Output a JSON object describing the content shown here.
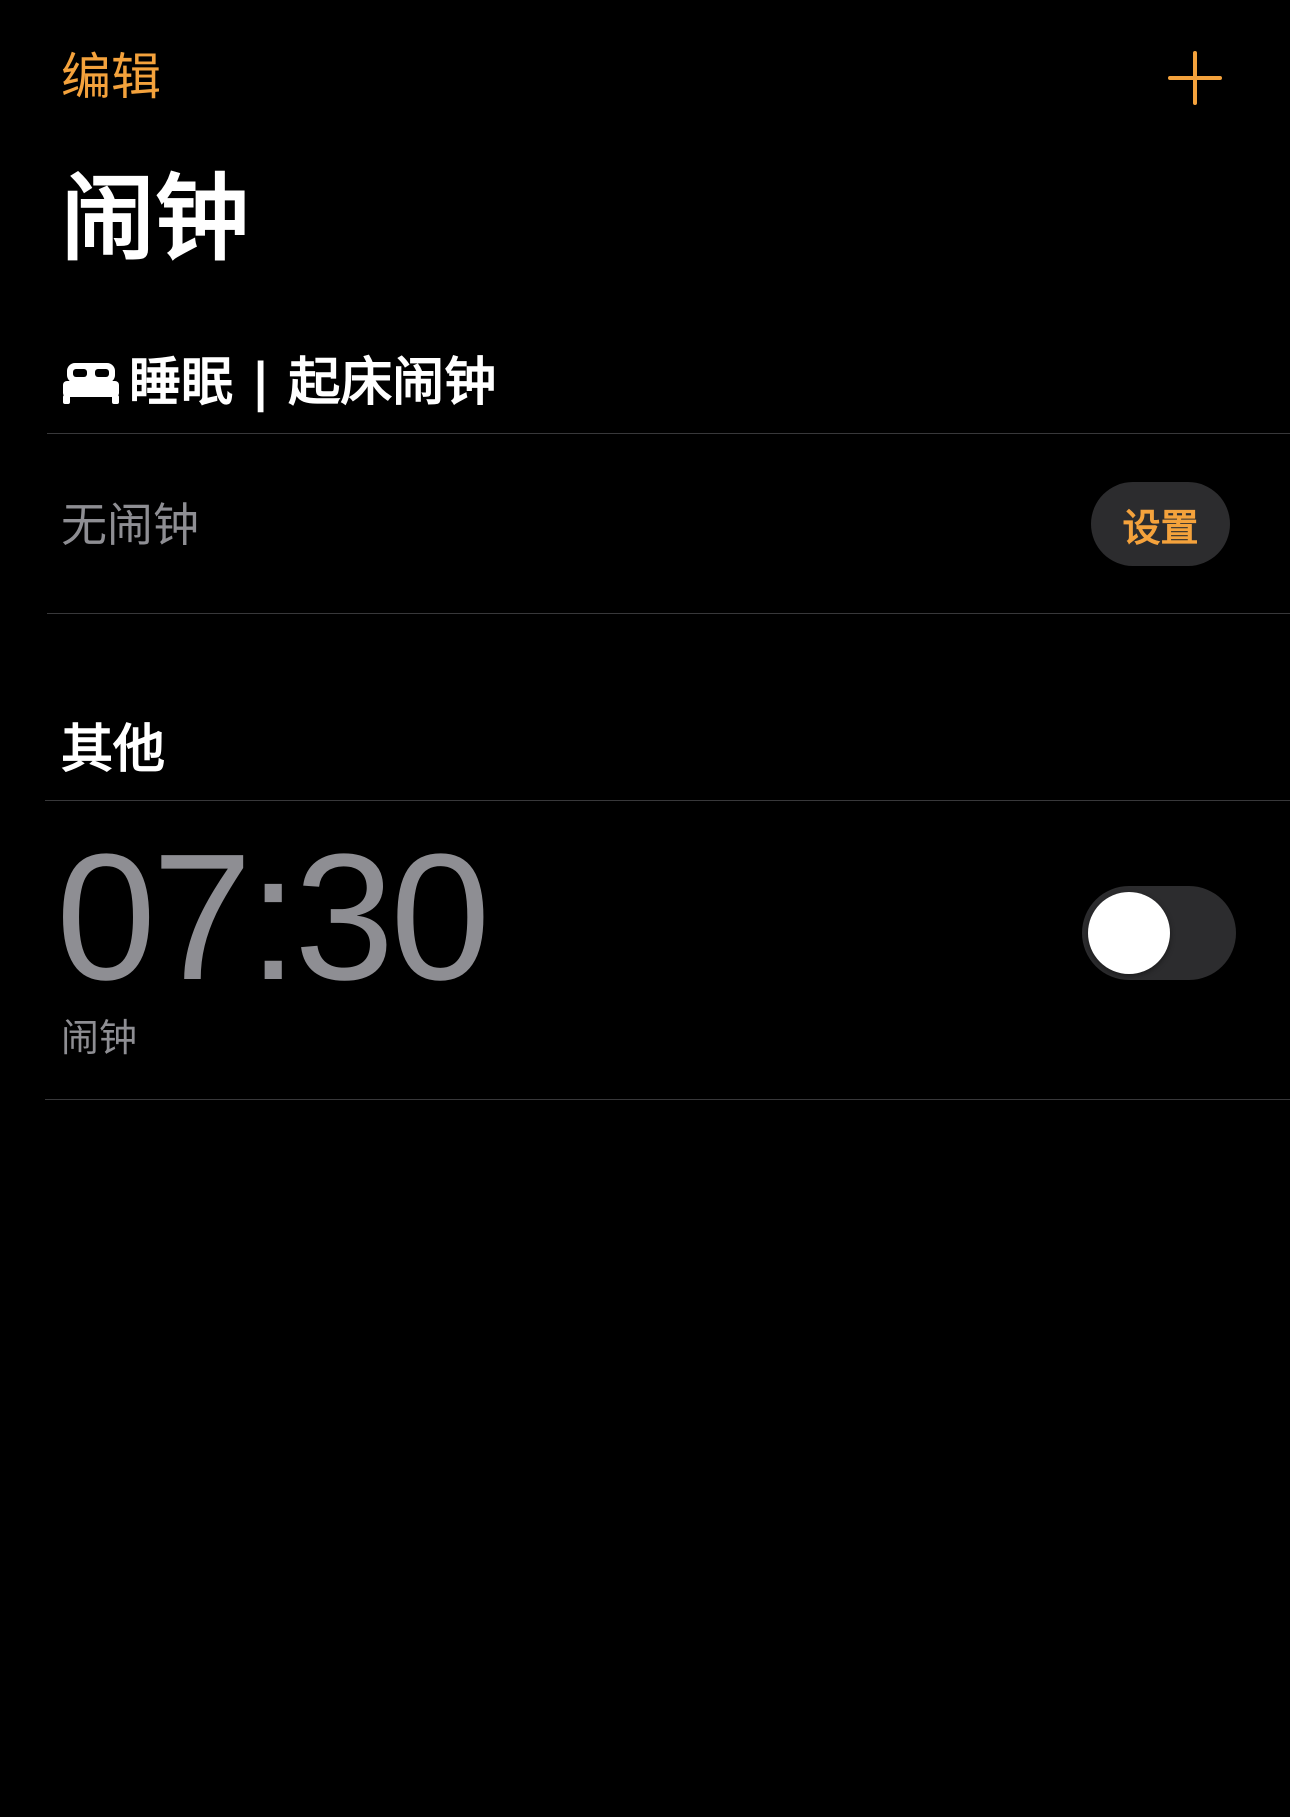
{
  "nav": {
    "edit_label": "编辑",
    "add_icon": "plus-icon"
  },
  "title": "闹钟",
  "sleep_section": {
    "icon": "bed-icon",
    "title": "睡眠 | 起床闹钟",
    "empty_text": "无闹钟",
    "setup_label": "设置"
  },
  "other_section": {
    "title": "其他",
    "alarms": [
      {
        "time": "07:30",
        "label": "闹钟",
        "enabled": false
      }
    ]
  },
  "colors": {
    "accent": "#F4A23C",
    "background": "#000000",
    "secondary_text": "#8E8E93",
    "control_fill": "#2C2C2E",
    "separator": "#38383A"
  }
}
